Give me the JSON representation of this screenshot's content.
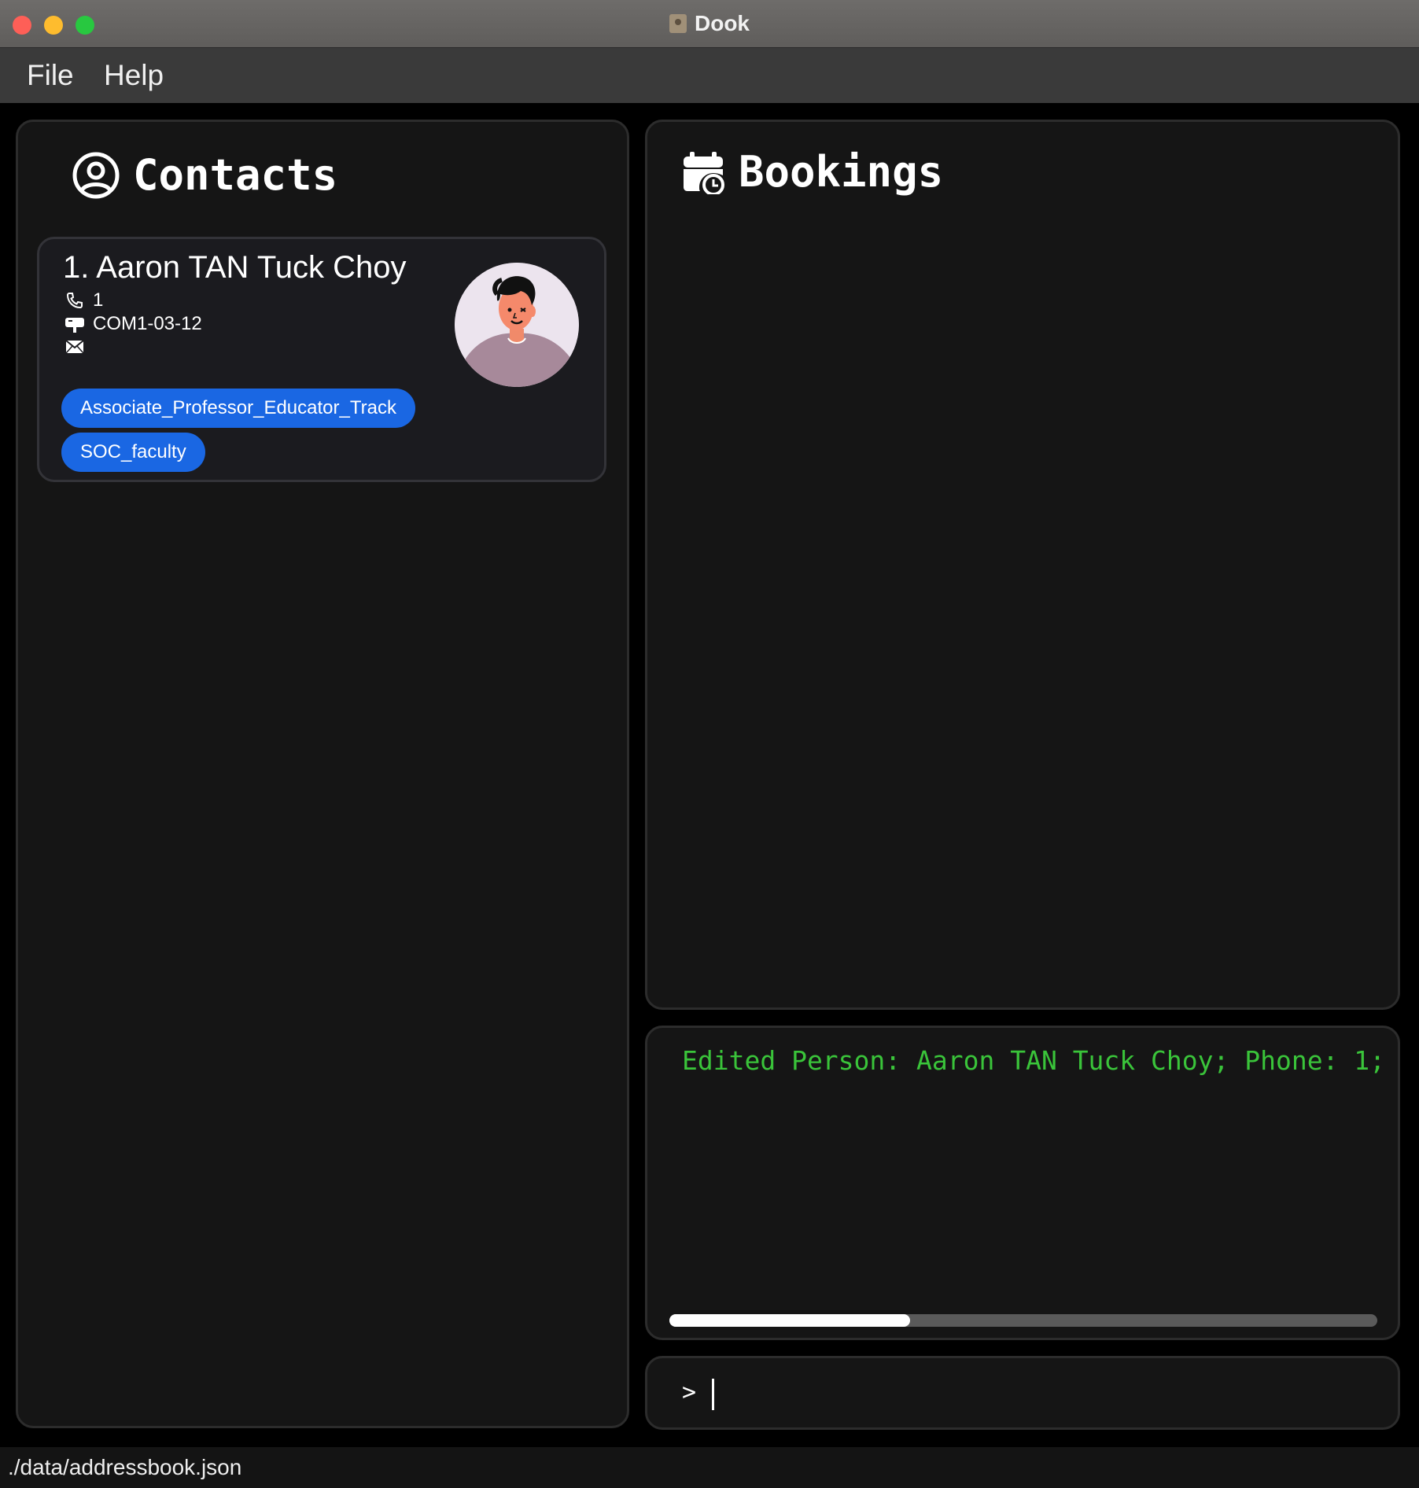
{
  "window": {
    "title": "Dook"
  },
  "menu": {
    "items": [
      {
        "label": "File"
      },
      {
        "label": "Help"
      }
    ]
  },
  "contacts": {
    "heading": "Contacts",
    "heading_icon": "user-circle-icon",
    "persons": [
      {
        "index_name": "1. Aaron TAN Tuck Choy",
        "phone": "1",
        "address": "COM1-03-12",
        "email": "",
        "tags": [
          "Associate_Professor_Educator_Track",
          "SOC_faculty"
        ],
        "avatar": "person-avatar-illustration"
      }
    ]
  },
  "bookings": {
    "heading": "Bookings",
    "heading_icon": "calendar-clock-icon"
  },
  "result": {
    "message": "Edited Person: Aaron TAN Tuck Choy; Phone: 1;",
    "scroll_fraction": 0.34,
    "color": "#3ac43a"
  },
  "command": {
    "prompt": ">",
    "value": ""
  },
  "status": {
    "path": "./data/addressbook.json"
  },
  "colors": {
    "tag": "#1a67e3",
    "panel": "#151515",
    "background": "#000000"
  }
}
